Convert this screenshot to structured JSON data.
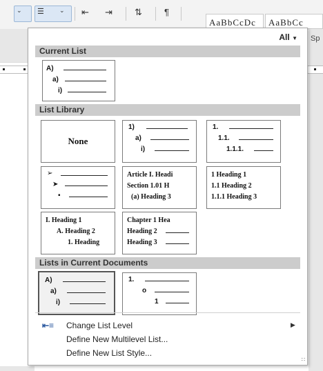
{
  "ribbon": {
    "style_preview_1": "AaBbCcDc",
    "style_preview_2": "AaBbCc",
    "style_fragment": "Sp"
  },
  "panel": {
    "filter_label": "All",
    "sections": {
      "current_list": "Current List",
      "list_library": "List Library",
      "lists_in_current_documents": "Lists in Current Documents"
    },
    "current_list_tile": {
      "markers": [
        "A)",
        "a)",
        "i)"
      ]
    },
    "library": {
      "none_label": "None",
      "tile_numbered": {
        "markers": [
          "1)",
          "a)",
          "i)"
        ]
      },
      "tile_decimal": {
        "markers": [
          "1.",
          "1.1.",
          "1.1.1."
        ]
      },
      "tile_bullets": {
        "markers": [
          "➢",
          "➤",
          "▪"
        ]
      },
      "tile_article": {
        "lines": [
          "Article I. Headi",
          "Section 1.01 H",
          "(a) Heading 3"
        ]
      },
      "tile_heading_decimal": {
        "lines": [
          "1 Heading 1",
          "1.1 Heading 2",
          "1.1.1 Heading 3"
        ]
      },
      "tile_heading_outline": {
        "lines": [
          "I. Heading 1",
          "A. Heading 2",
          "1. Heading"
        ]
      },
      "tile_chapter": {
        "lines": [
          "Chapter 1 Hea",
          "Heading 2",
          "Heading 3"
        ]
      }
    },
    "current_documents": {
      "tile_alpha": {
        "markers": [
          "A)",
          "a)",
          "i)"
        ]
      },
      "tile_mixed": {
        "markers": [
          "1.",
          "o",
          "1"
        ]
      }
    },
    "commands": {
      "change_list_level": "Change List Level",
      "define_multilevel": "Define New Multilevel List...",
      "define_list_style": "Define New List Style..."
    }
  }
}
